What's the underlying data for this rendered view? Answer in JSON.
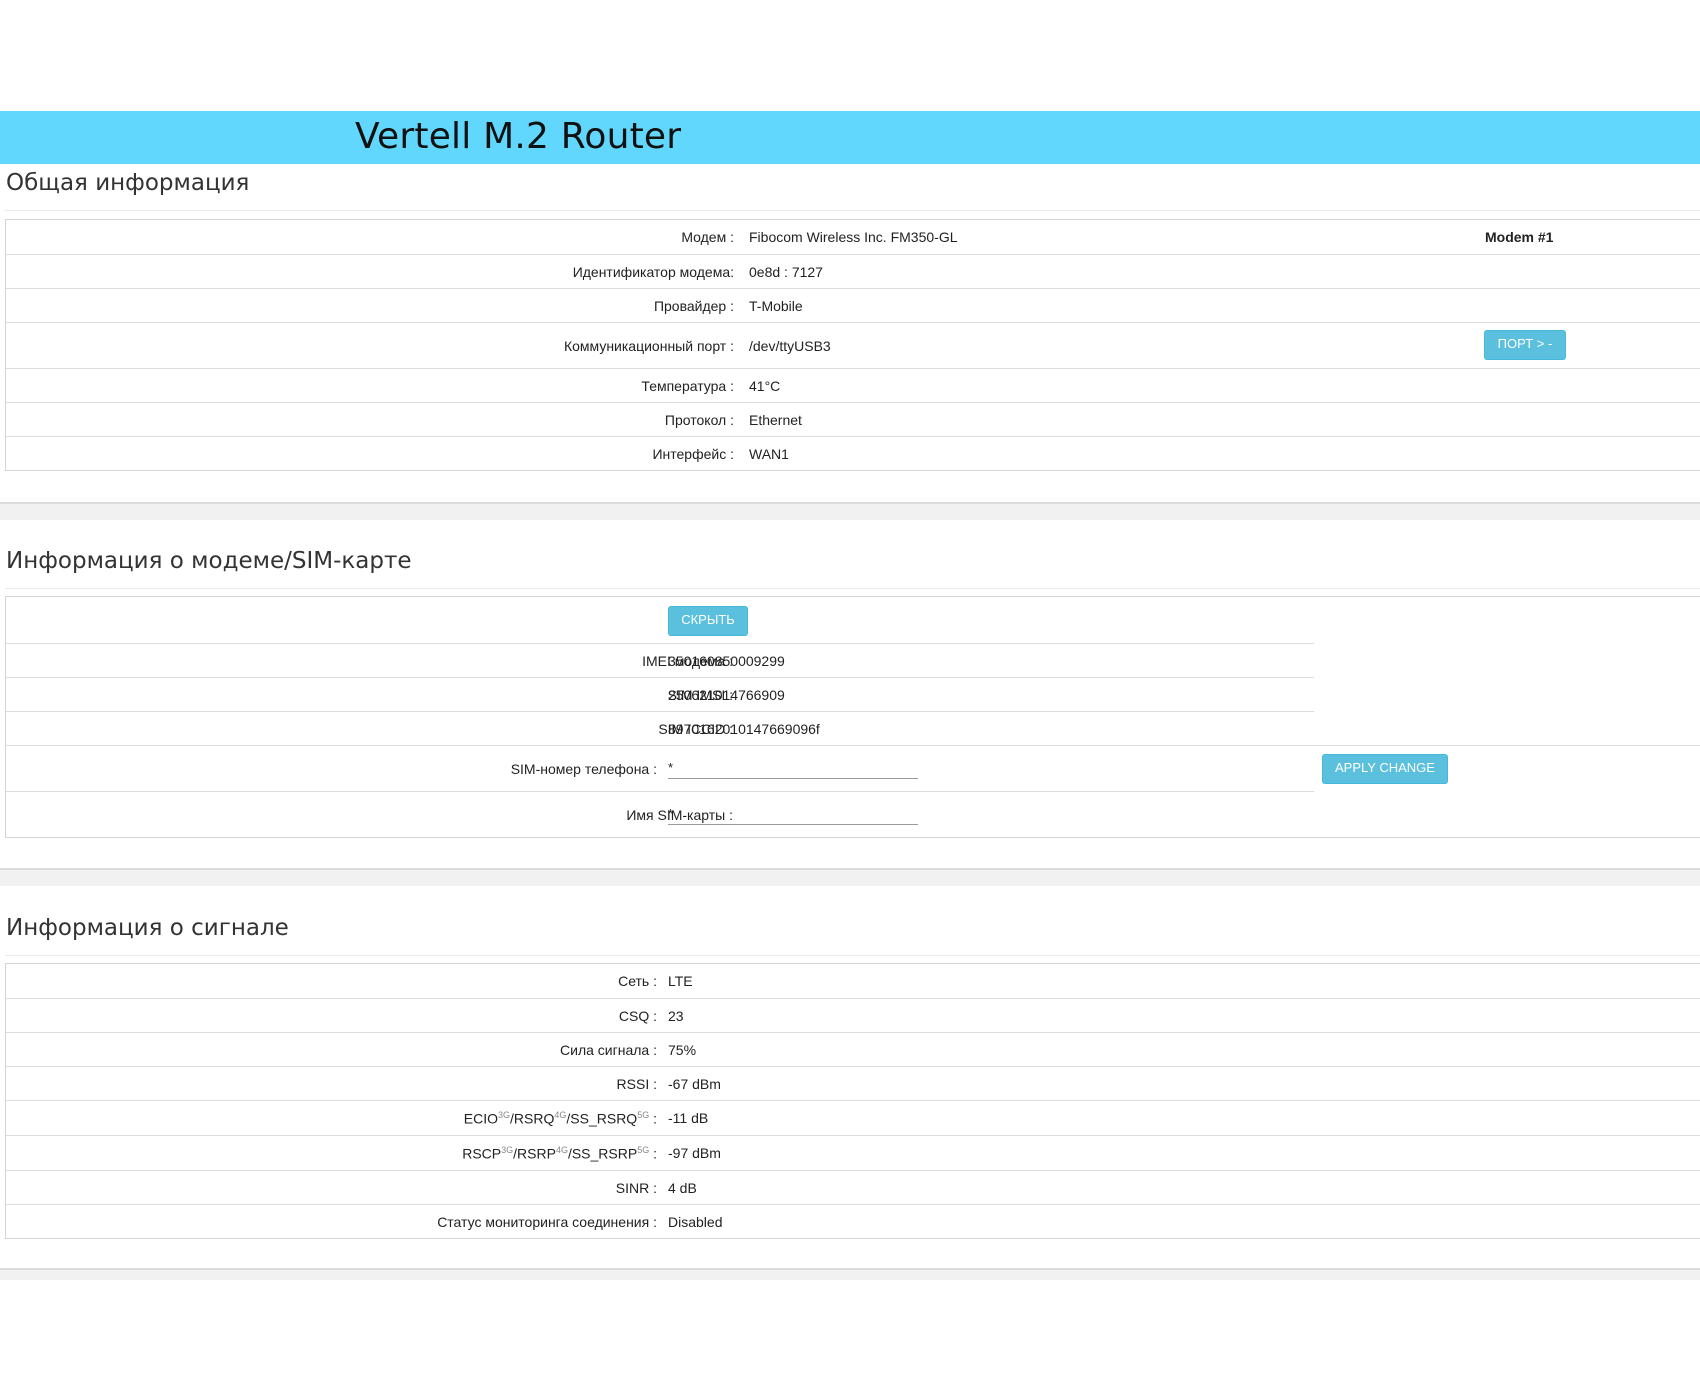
{
  "header": {
    "title": "Vertell M.2 Router"
  },
  "general": {
    "title": "Общая информация",
    "modem_badge": "Modem #1",
    "port_button": "ПОРТ > -",
    "rows": [
      {
        "label": "Модем :",
        "value": "Fibocom Wireless Inc. FM350-GL"
      },
      {
        "label": "Идентификатор модема:",
        "value": "0e8d : 7127"
      },
      {
        "label": "Провайдер :",
        "value": "T-Mobile"
      },
      {
        "label": "Коммуникационный порт :",
        "value": "/dev/ttyUSB3"
      },
      {
        "label": "Температура :",
        "value": "41°C"
      },
      {
        "label": "Протокол :",
        "value": "Ethernet"
      },
      {
        "label": "Интерфейс :",
        "value": "WAN1"
      }
    ]
  },
  "sim": {
    "title": "Информация о модеме/SIM-карте",
    "hide_button": "СКРЫТЬ",
    "apply_button": "APPLY CHANGE",
    "rows": [
      {
        "label": "IMEI модема :",
        "value": "350160850009299"
      },
      {
        "label": "SIM IMSI :",
        "value": "250621014766909"
      },
      {
        "label": "SIM ICCID :",
        "value": "8970162010147669096f"
      }
    ],
    "phone": {
      "label": "SIM-номер телефона :",
      "value": "*"
    },
    "name": {
      "label": "Имя SIM-карты :",
      "value": "*"
    }
  },
  "signal": {
    "title": "Информация о сигнале",
    "rows": [
      {
        "label": "Сеть :",
        "value": "LTE"
      },
      {
        "label": "CSQ :",
        "value": "23"
      },
      {
        "label": "Сила сигнала :",
        "value": "75%"
      },
      {
        "label": "RSSI :",
        "value": "-67 dBm"
      },
      {
        "label_parts": {
          "a": "ECIO",
          "a_sup": "3G",
          "b": "/RSRQ",
          "b_sup": "4G",
          "c": "/SS_RSRQ",
          "c_sup": "5G",
          "end": " :"
        },
        "value": "-11 dB"
      },
      {
        "label_parts": {
          "a": "RSCP",
          "a_sup": "3G",
          "b": "/RSRP",
          "b_sup": "4G",
          "c": "/SS_RSRP",
          "c_sup": "5G",
          "end": " :"
        },
        "value": "-97 dBm"
      },
      {
        "label": "SINR :",
        "value": "4 dB"
      },
      {
        "label": "Статус мониторинга соединения :",
        "value": "Disabled"
      }
    ]
  }
}
